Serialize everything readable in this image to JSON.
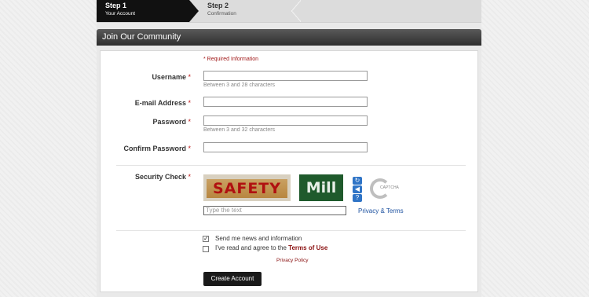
{
  "steps": [
    {
      "num": "Step 1",
      "sub": "Your Account"
    },
    {
      "num": "Step 2",
      "sub": "Confirmation"
    }
  ],
  "panel": {
    "title": "Join Our Community"
  },
  "required_note": "* Required Information",
  "fields": {
    "username": {
      "label": "Username",
      "hint": "Between 3 and 28 characters",
      "value": ""
    },
    "email": {
      "label": "E-mail Address",
      "value": ""
    },
    "password": {
      "label": "Password",
      "hint": "Between 3 and 32 characters",
      "value": ""
    },
    "confirm_password": {
      "label": "Confirm Password",
      "value": ""
    }
  },
  "required_star": "*",
  "security": {
    "label": "Security Check",
    "captcha_word1": "SAFETY",
    "captcha_word2": "Mill",
    "placeholder": "Type the text",
    "privacy_terms": "Privacy & Terms",
    "logo_text": "CAPTCHA"
  },
  "checkboxes": {
    "news": {
      "label": "Send me news and information",
      "checked": true
    },
    "terms": {
      "label": "I've read and agree to the",
      "link": "Terms of Use",
      "checked": false
    }
  },
  "privacy_policy": "Privacy Policy",
  "submit_label": "Create Account",
  "icons": {
    "refresh": "refresh-icon",
    "audio": "audio-icon",
    "help": "help-icon"
  },
  "colors": {
    "accent_red": "#a01818",
    "link_blue": "#1a4f9e",
    "header_dark": "#2e2e2e"
  }
}
